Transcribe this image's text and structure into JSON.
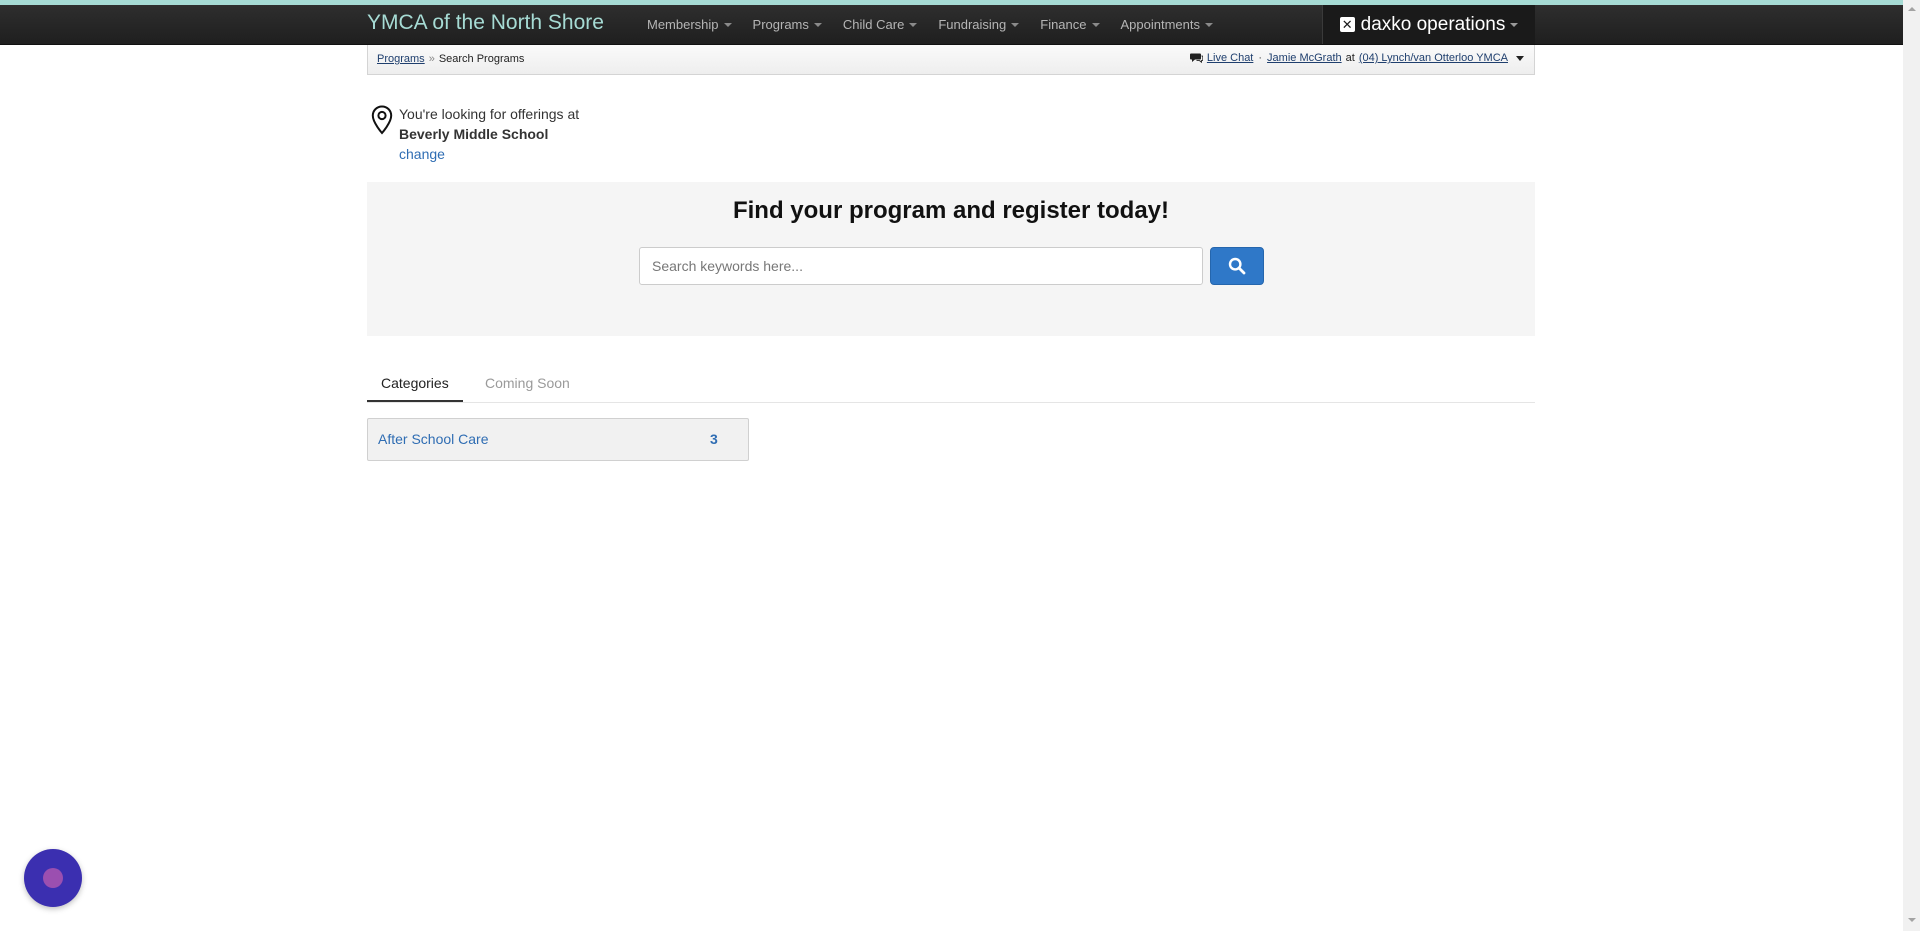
{
  "navbar": {
    "brand": "YMCA of the North Shore",
    "menu": [
      {
        "label": "Membership"
      },
      {
        "label": "Programs"
      },
      {
        "label": "Child Care"
      },
      {
        "label": "Fundraising"
      },
      {
        "label": "Finance"
      },
      {
        "label": "Appointments"
      }
    ],
    "product_name": "daxko operations",
    "colors": {
      "bar_background": "#262626",
      "brand_text": "#a6dbd4",
      "accent_stripe": "#a6dbd4"
    }
  },
  "subbar": {
    "breadcrumb": {
      "link": "Programs",
      "separator": "»",
      "current": "Search Programs"
    },
    "live_chat": "Live Chat",
    "dot_separator": "·",
    "user": "Jamie McGrath",
    "at_text": "at",
    "branch": "(04) Lynch/van Otterloo YMCA"
  },
  "location": {
    "prefix": "You're looking for offerings at",
    "name": "Beverly Middle School",
    "change_label": "change",
    "icon": "map-pin-icon"
  },
  "search": {
    "title": "Find your program and register today!",
    "placeholder": "Search keywords here...",
    "value": "",
    "button_icon": "search-icon",
    "button_color": "#2f78c8"
  },
  "tabs": [
    {
      "label": "Categories",
      "active": true
    },
    {
      "label": "Coming Soon",
      "active": false
    }
  ],
  "categories": [
    {
      "name": "After School Care",
      "count": "3"
    }
  ],
  "chat_widget": {
    "icon": "chat-bubble-icon",
    "color": "#3b2fb0"
  }
}
